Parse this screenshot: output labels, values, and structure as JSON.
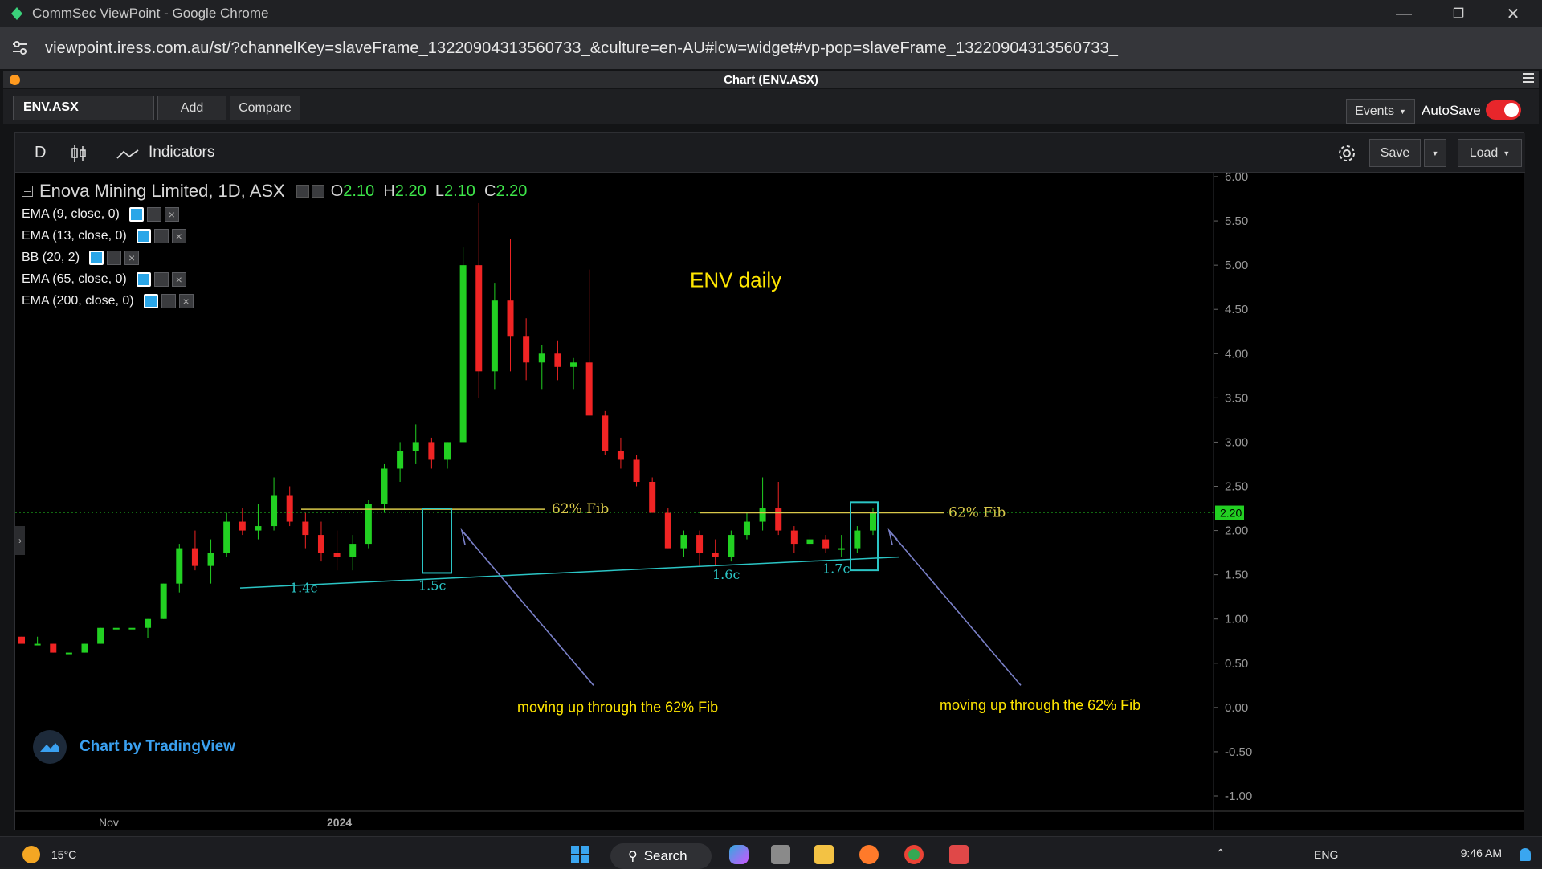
{
  "window": {
    "title": "CommSec ViewPoint - Google Chrome",
    "url": "viewpoint.iress.com.au/st/?channelKey=slaveFrame_13220904313560733_&culture=en-AU#lcw=widget#vp-pop=slaveFrame_13220904313560733_"
  },
  "panel": {
    "title": "Chart (ENV.ASX)"
  },
  "toolbar": {
    "symbol": "ENV.ASX",
    "add_label": "Add",
    "compare_label": "Compare",
    "events_label": "Events",
    "autosave_label": "AutoSave",
    "autosave_on": true
  },
  "chart_toolbar": {
    "interval": "D",
    "indicators_label": "Indicators",
    "save_label": "Save",
    "load_label": "Load"
  },
  "legend": {
    "title": "Enova Mining Limited, 1D, ASX",
    "o_label": "O",
    "o": "2.10",
    "h_label": "H",
    "h": "2.20",
    "l_label": "L",
    "l": "2.10",
    "c_label": "C",
    "c": "2.20",
    "indicators": [
      "EMA (9, close, 0)",
      "EMA (13, close, 0)",
      "BB (20, 2)",
      "EMA (65, close, 0)",
      "EMA (200, close, 0)"
    ]
  },
  "watermark": "Chart by TradingView",
  "chart_data": {
    "type": "candlestick",
    "y_ticks": [
      "6.00",
      "5.50",
      "5.00",
      "4.50",
      "4.00",
      "3.50",
      "3.00",
      "2.50",
      "2.00",
      "1.50",
      "1.00",
      "0.50",
      "0.00",
      "-0.50",
      "-1.00"
    ],
    "ylim": [
      -1.0,
      6.0
    ],
    "x_labels": [
      "Nov",
      "2024"
    ],
    "last_price": "2.20",
    "annotations": {
      "title": "ENV daily",
      "fib_label_1": "62% Fib",
      "fib_label_2": "62% Fib",
      "lows": [
        "1.4c",
        "1.5c",
        "1.6c",
        "1.7c"
      ],
      "note_1": "moving up through the 62% Fib",
      "note_2": "moving up through the 62% Fib"
    },
    "colors": {
      "up": "#22d022",
      "down": "#f02424",
      "fib": "#d8c84a",
      "trend": "#2bc5c5",
      "note": "#ffe600",
      "arrow": "#7a80c8"
    },
    "candles": [
      [
        0.8,
        0.8,
        0.72,
        0.72
      ],
      [
        0.72,
        0.8,
        0.72,
        0.72
      ],
      [
        0.72,
        0.72,
        0.62,
        0.62
      ],
      [
        0.62,
        0.62,
        0.62,
        0.62
      ],
      [
        0.62,
        0.72,
        0.62,
        0.72
      ],
      [
        0.72,
        0.9,
        0.72,
        0.9
      ],
      [
        0.9,
        0.9,
        0.9,
        0.9
      ],
      [
        0.9,
        0.9,
        0.9,
        0.9
      ],
      [
        0.9,
        1.0,
        0.78,
        1.0
      ],
      [
        1.0,
        1.4,
        1.0,
        1.4
      ],
      [
        1.4,
        1.85,
        1.3,
        1.8
      ],
      [
        1.8,
        2.0,
        1.55,
        1.6
      ],
      [
        1.6,
        1.9,
        1.4,
        1.75
      ],
      [
        1.75,
        2.2,
        1.7,
        2.1
      ],
      [
        2.1,
        2.25,
        1.95,
        2.0
      ],
      [
        2.0,
        2.3,
        1.9,
        2.05
      ],
      [
        2.05,
        2.6,
        2.0,
        2.4
      ],
      [
        2.4,
        2.5,
        2.05,
        2.1
      ],
      [
        2.1,
        2.2,
        1.8,
        1.95
      ],
      [
        1.95,
        2.1,
        1.65,
        1.75
      ],
      [
        1.75,
        2.0,
        1.55,
        1.7
      ],
      [
        1.7,
        1.95,
        1.55,
        1.85
      ],
      [
        1.85,
        2.35,
        1.8,
        2.3
      ],
      [
        2.3,
        2.75,
        2.2,
        2.7
      ],
      [
        2.7,
        3.0,
        2.55,
        2.9
      ],
      [
        2.9,
        3.2,
        2.75,
        3.0
      ],
      [
        3.0,
        3.05,
        2.7,
        2.8
      ],
      [
        2.8,
        3.0,
        2.7,
        3.0
      ],
      [
        3.0,
        5.2,
        3.0,
        5.0
      ],
      [
        5.0,
        5.7,
        3.5,
        3.8
      ],
      [
        3.8,
        4.8,
        3.6,
        4.6
      ],
      [
        4.6,
        5.3,
        3.8,
        4.2
      ],
      [
        4.2,
        4.4,
        3.7,
        3.9
      ],
      [
        3.9,
        4.1,
        3.6,
        4.0
      ],
      [
        4.0,
        4.15,
        3.7,
        3.85
      ],
      [
        3.85,
        3.95,
        3.6,
        3.9
      ],
      [
        3.9,
        4.95,
        3.3,
        3.3
      ],
      [
        3.3,
        3.35,
        2.85,
        2.9
      ],
      [
        2.9,
        3.05,
        2.7,
        2.8
      ],
      [
        2.8,
        2.85,
        2.5,
        2.55
      ],
      [
        2.55,
        2.6,
        2.2,
        2.2
      ],
      [
        2.2,
        2.25,
        1.8,
        1.8
      ],
      [
        1.8,
        2.0,
        1.7,
        1.95
      ],
      [
        1.95,
        2.0,
        1.6,
        1.75
      ],
      [
        1.75,
        1.9,
        1.6,
        1.7
      ],
      [
        1.7,
        2.0,
        1.65,
        1.95
      ],
      [
        1.95,
        2.2,
        1.9,
        2.1
      ],
      [
        2.1,
        2.6,
        2.0,
        2.25
      ],
      [
        2.25,
        2.55,
        1.95,
        2.0
      ],
      [
        2.0,
        2.05,
        1.75,
        1.85
      ],
      [
        1.85,
        2.0,
        1.75,
        1.9
      ],
      [
        1.9,
        1.95,
        1.75,
        1.8
      ],
      [
        1.8,
        1.95,
        1.7,
        1.8
      ],
      [
        1.8,
        2.05,
        1.75,
        2.0
      ],
      [
        2.0,
        2.25,
        1.95,
        2.2
      ]
    ]
  }
}
